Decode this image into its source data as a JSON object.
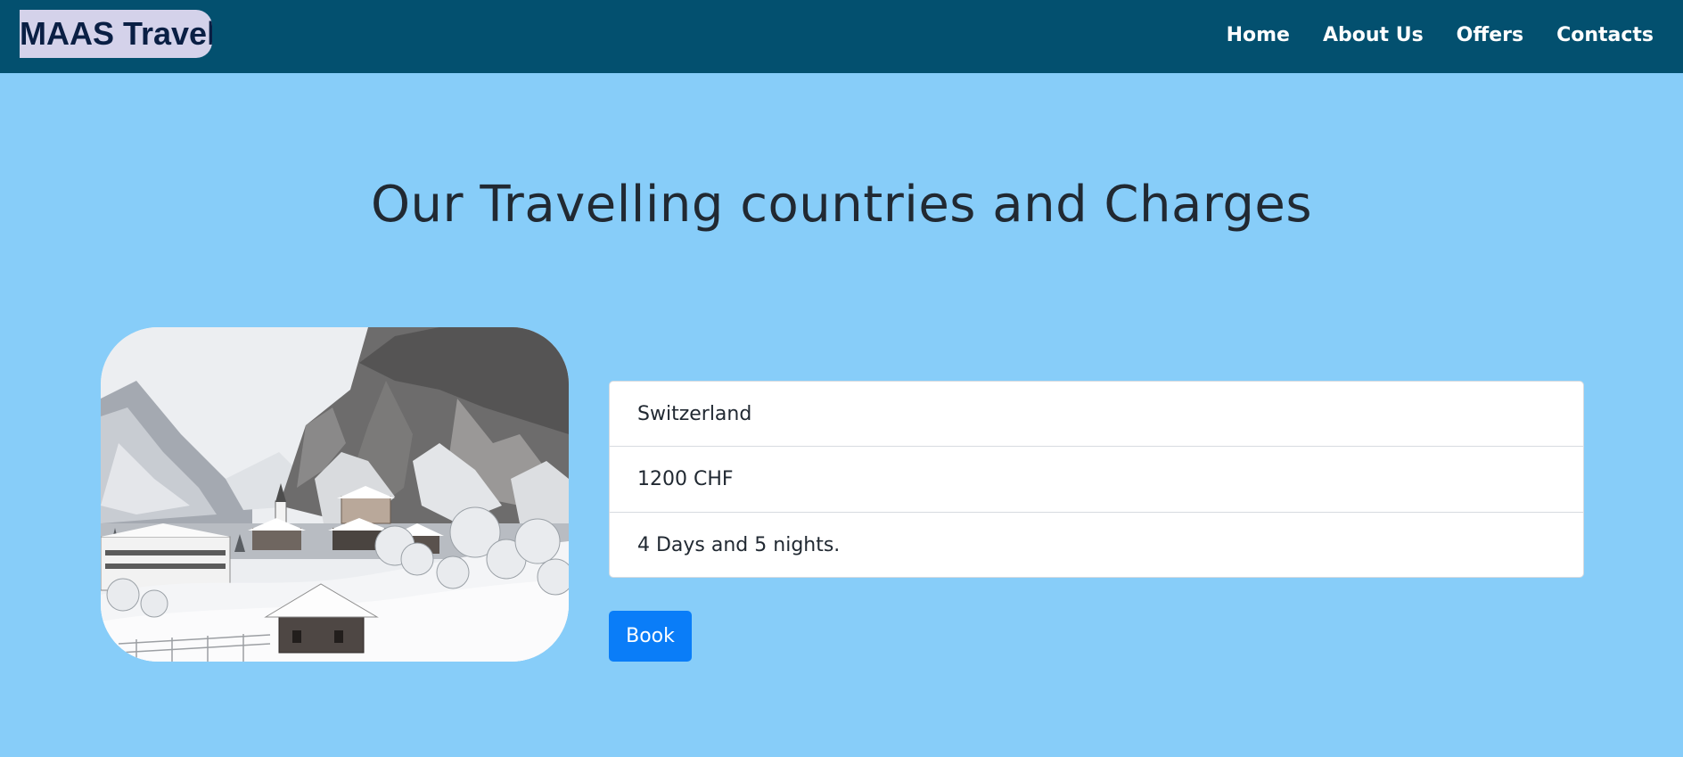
{
  "header": {
    "brand": "MAAS Travel",
    "nav": [
      "Home",
      "About Us",
      "Offers",
      "Contacts"
    ]
  },
  "main": {
    "title": "Our Travelling countries and Charges",
    "offer": {
      "image_icon": "snowy-village-photo",
      "country": "Switzerland",
      "price": "1200 CHF",
      "duration": "4 Days and 5 nights.",
      "book_label": "Book"
    }
  },
  "colors": {
    "navbar": "#03506f",
    "page_background": "#87cdf9",
    "brand_highlight": "#d4d2ea",
    "button": "#0a7df8"
  }
}
